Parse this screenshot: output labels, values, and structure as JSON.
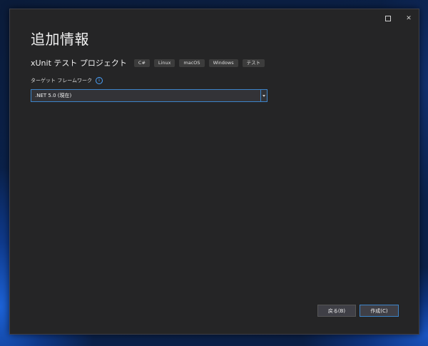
{
  "window": {
    "title": "追加情報",
    "controls": {
      "maximize_icon": "maximize-icon",
      "close_glyph": "✕"
    }
  },
  "project": {
    "name": "xUnit テスト プロジェクト",
    "tags": [
      "C#",
      "Linux",
      "macOS",
      "Windows",
      "テスト"
    ]
  },
  "framework": {
    "label": "ターゲット フレームワーク",
    "info_glyph": "i",
    "selected": ".NET 5.0 (現在)"
  },
  "footer": {
    "back_label": "戻る(B)",
    "create_label": "作成(C)"
  },
  "colors": {
    "window_bg": "#252526",
    "accent": "#3d84c9",
    "info": "#4aa3ff"
  }
}
